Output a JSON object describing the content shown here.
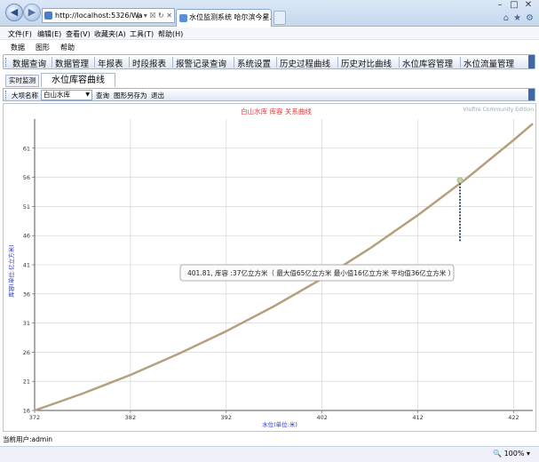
{
  "browser": {
    "address": "http://localhost:5326/Wa",
    "address_actions": "ρ ▾ ☒ ↻ ✕",
    "tab_title": "水位监测系统 哈尔滨今星...",
    "tab_close": "✕",
    "zoom": "🔍 100%  ▾"
  },
  "menus": {
    "browser": [
      "文件(F)",
      "编辑(E)",
      "查看(V)",
      "收藏夹(A)",
      "工具(T)",
      "帮助(H)"
    ],
    "app": [
      "数据",
      "图形",
      "帮助"
    ]
  },
  "nav": [
    "数据查询",
    "数据管理",
    "年报表",
    "时段报表",
    "报警记录查询",
    "系统设置",
    "历史过程曲线",
    "历史对比曲线",
    "水位库容管理",
    "水位流量管理"
  ],
  "subtabs": {
    "tab1": "实时监测",
    "tab2": "水位库容曲线"
  },
  "toolbar": {
    "label": "大坝名称",
    "reservoir": "白山水库",
    "query": "查询",
    "save_as": "图形另存为",
    "exit": "退出"
  },
  "status": {
    "user": "当前用户:admin"
  },
  "colors": {
    "curve": "#b5a07e",
    "title": "#e23a3a",
    "axis_label": "#2233cc",
    "marker": "#2b3a6b"
  },
  "chart_data": {
    "type": "line",
    "title": "白山水库 库容 关系曲线",
    "watermark": "Visifire Community Edition",
    "xlabel": "水位(单位:米)",
    "ylabel": "库容(单位:亿立方米)",
    "xlim": [
      372,
      424
    ],
    "ylim": [
      16,
      66
    ],
    "xticks": [
      372,
      382,
      392,
      402,
      412,
      422
    ],
    "yticks": [
      16,
      21,
      26,
      31,
      36,
      41,
      46,
      51,
      56,
      61
    ],
    "series": [
      {
        "x": [
          372,
          377,
          382,
          387,
          392,
          397,
          402,
          407,
          412,
          417,
          422,
          424
        ],
        "y": [
          16,
          18.9,
          22.1,
          25.7,
          29.6,
          33.9,
          38.6,
          43.8,
          49.5,
          55.7,
          62.4,
          65.2
        ]
      }
    ],
    "marker": {
      "x": 416.4,
      "y_top": 55.5,
      "y_bottom": 45
    },
    "tooltip": "401.81, 库容 :37亿立方米（ 最大值65亿立方米   最小值16亿立方米   平均值36亿立方米 ）"
  }
}
